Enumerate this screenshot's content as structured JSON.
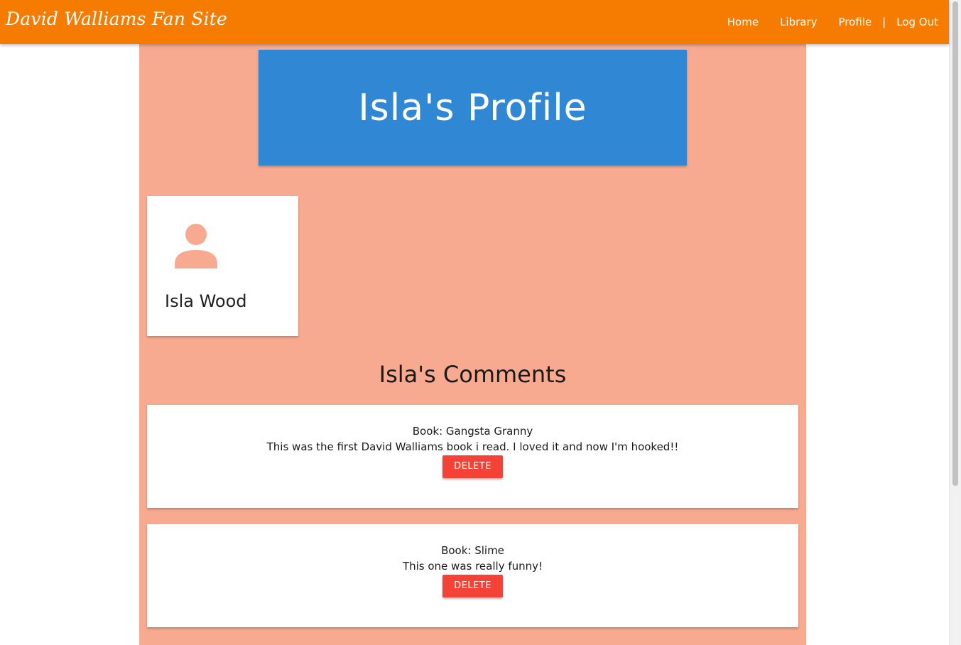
{
  "navbar": {
    "brand": "David Walliams Fan Site",
    "links": [
      "Home",
      "Library",
      "Profile",
      "Log Out"
    ],
    "separator": "|",
    "background": "#f57c00"
  },
  "hero": {
    "title": "Isla's Profile",
    "background": "#3087d4"
  },
  "user": {
    "icon": "person-icon",
    "name": "Isla Wood"
  },
  "comments": {
    "title": "Isla's Comments",
    "items": [
      {
        "book": "Book: Gangsta Granny",
        "text": "This was the first David Walliams book i read. I loved it and now I'm hooked!!",
        "delete_label": "DELETE"
      },
      {
        "book": "Book: Slime",
        "text": "This one was really funny!",
        "delete_label": "DELETE"
      }
    ]
  },
  "colors": {
    "page_background": "#f8aa90",
    "delete_button": "#f44336"
  }
}
